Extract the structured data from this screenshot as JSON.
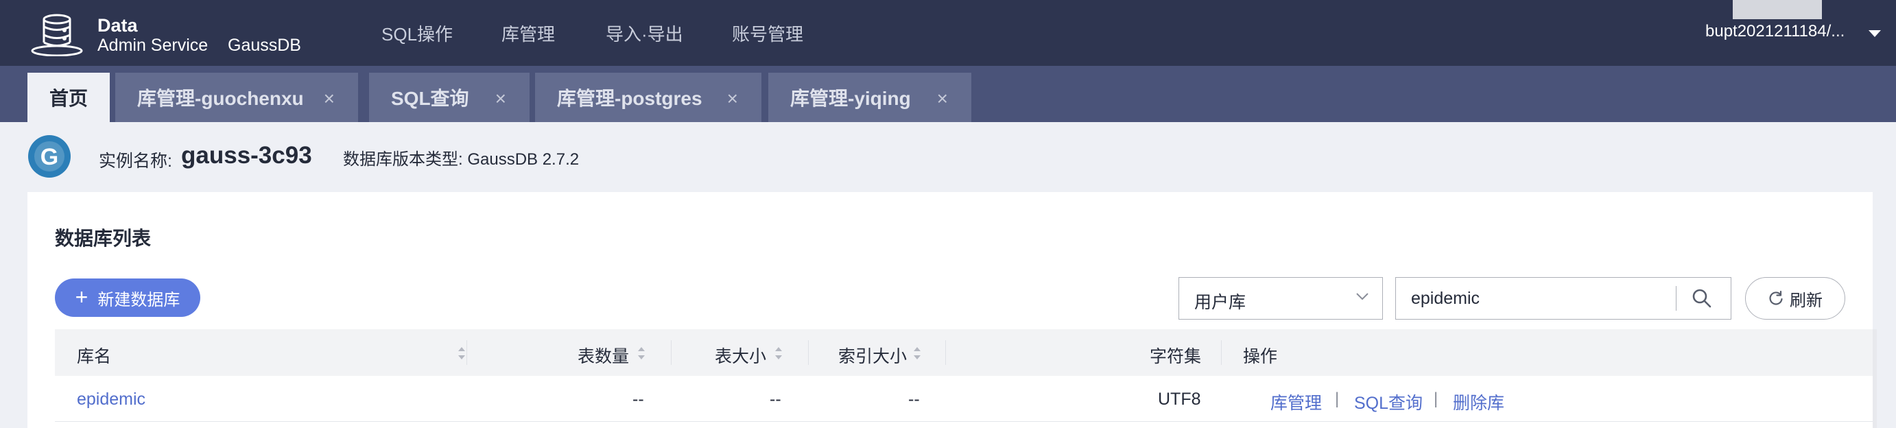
{
  "header": {
    "brand_title": "Data",
    "brand_subtitle": "Admin Service",
    "brand_db": "GaussDB",
    "nav": [
      "SQL操作",
      "库管理",
      "导入·导出",
      "账号管理"
    ],
    "user": "bupt2021211184/..."
  },
  "tabs": [
    {
      "label": "首页",
      "active": true
    },
    {
      "label": "库管理-guochenxu",
      "close": "×"
    },
    {
      "label": "SQL查询",
      "close": "×"
    },
    {
      "label": "库管理-postgres",
      "close": "×"
    },
    {
      "label": "库管理-yiqing",
      "close": "×"
    }
  ],
  "instance": {
    "icon_letter": "G",
    "name_label": "实例名称:",
    "name": "gauss-3c93",
    "version_label": "数据库版本类型: GaussDB 2.7.2"
  },
  "db_list": {
    "title": "数据库列表",
    "new_button": "新建数据库",
    "plus": "+",
    "filter_selected": "用户库",
    "search_value": "epidemic",
    "refresh_button": "刷新"
  },
  "table": {
    "columns": [
      "库名",
      "表数量",
      "表大小",
      "索引大小",
      "字符集",
      "操作"
    ],
    "rows": [
      {
        "name": "epidemic",
        "tables": "--",
        "table_size": "--",
        "index_size": "--",
        "charset": "UTF8",
        "actions": [
          "库管理",
          "SQL查询",
          "删除库"
        ],
        "sep": "|"
      }
    ]
  },
  "colors": {
    "topbar": "#2e3550",
    "tabbar": "#4a5379",
    "accent": "#5e7ce0",
    "link": "#526ecc"
  },
  "icons": [
    "database-logo-icon",
    "gaussdb-icon",
    "chevron-down-icon",
    "search-icon",
    "refresh-icon",
    "sort-icon",
    "close-icon"
  ]
}
